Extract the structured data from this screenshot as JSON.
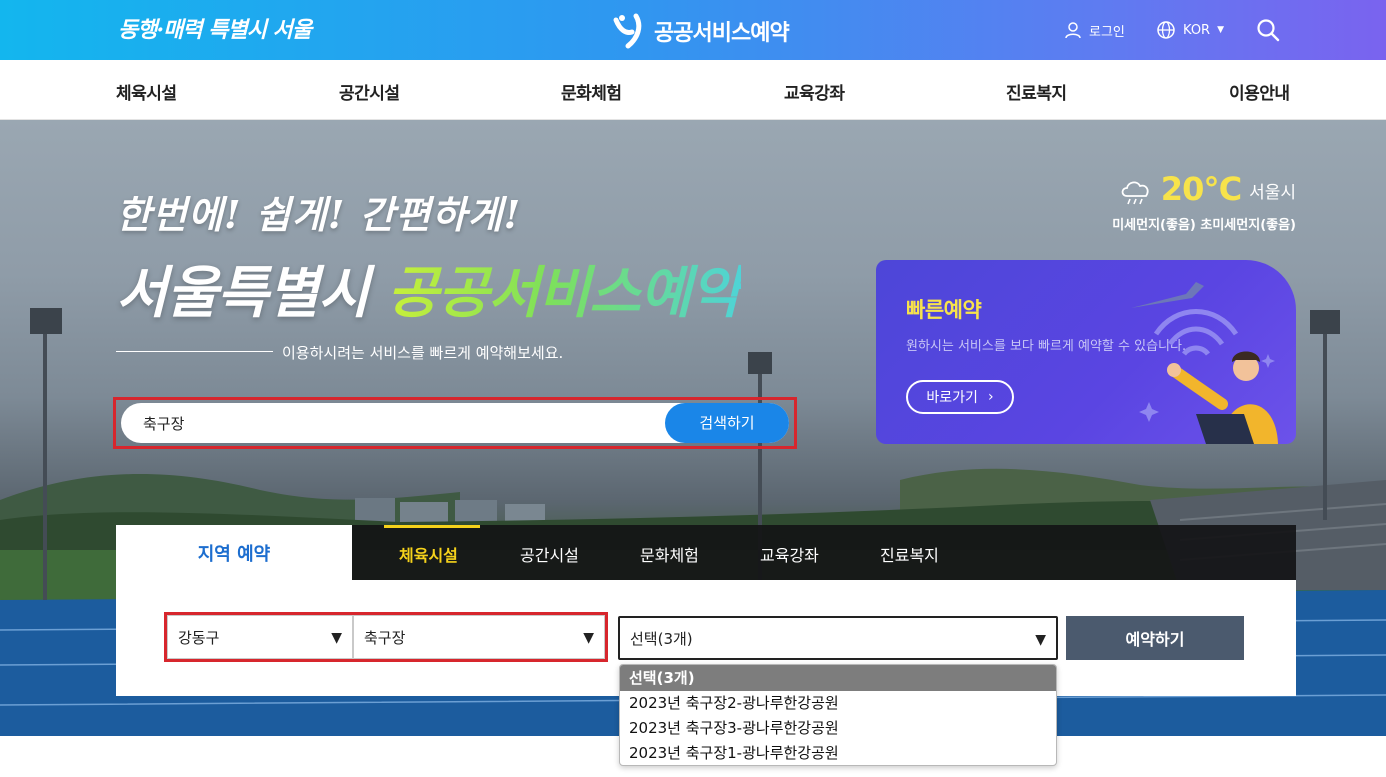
{
  "header": {
    "slogan": "동행·매력 특별시 서울",
    "brand_name": "공공서비스예약",
    "login_label": "로그인",
    "language": "KOR"
  },
  "gnb": {
    "items": [
      {
        "label": "체육시설"
      },
      {
        "label": "공간시설"
      },
      {
        "label": "문화체험"
      },
      {
        "label": "교육강좌"
      },
      {
        "label": "진료복지"
      },
      {
        "label": "이용안내"
      }
    ]
  },
  "hero": {
    "headline1": "한번에! 쉽게! 간편하게!",
    "headline2_prefix": "서울특별시",
    "headline2_accent": "공공서비스예약",
    "subtitle": "이용하시려는 서비스를 빠르게 예약해보세요.",
    "search_value": "축구장",
    "search_button": "검색하기"
  },
  "weather": {
    "temperature": "20℃",
    "city": "서울시",
    "dust": "미세먼지(좋음) 초미세먼지(좋음)"
  },
  "quick": {
    "title": "빠른예약",
    "description": "원하시는 서비스를 보다 빠르게 예약할 수 있습니다.",
    "button": "바로가기"
  },
  "reservation": {
    "region_tab": "지역 예약",
    "categories": [
      {
        "label": "체육시설",
        "active": true
      },
      {
        "label": "공간시설",
        "active": false
      },
      {
        "label": "문화체험",
        "active": false
      },
      {
        "label": "교육강좌",
        "active": false
      },
      {
        "label": "진료복지",
        "active": false
      }
    ],
    "district": "강동구",
    "facility_type": "축구장",
    "facility_select": "선택(3개)",
    "reserve_button": "예약하기",
    "dropdown_options": [
      {
        "label": "선택(3개)",
        "selected": true
      },
      {
        "label": "2023년 축구장2-광나루한강공원",
        "selected": false
      },
      {
        "label": "2023년 축구장3-광나루한강공원",
        "selected": false
      },
      {
        "label": "2023년 축구장1-광나루한강공원",
        "selected": false
      }
    ]
  },
  "colors": {
    "primary_blue": "#1a86e8",
    "highlight_red": "#d7262d",
    "active_yellow": "#f5d21b",
    "quick_purple": "#5a45e2"
  }
}
